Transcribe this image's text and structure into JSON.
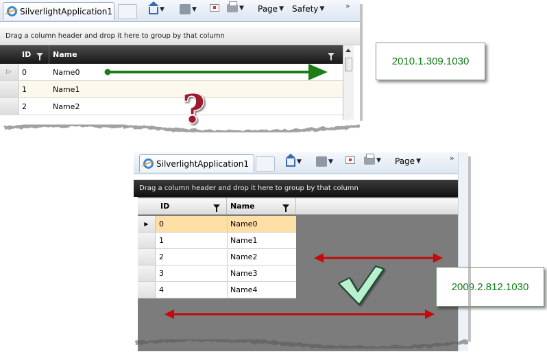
{
  "colors": {
    "arrow_green": "#1e7d16",
    "arrow_red": "#c40a0a",
    "question_mark": "#9e1a2e",
    "check_mark": "#b9f0cf",
    "version_text": "#0e7a14",
    "selected_row": "#ffdfa6"
  },
  "top_shot": {
    "tab_title": "SilverlightApplication1",
    "toolbar": {
      "page_label": "Page",
      "safety_label": "Safety"
    },
    "group_panel_text": "Drag a column header and drop it here to group by that column",
    "columns": [
      "ID",
      "Name"
    ],
    "rows": [
      {
        "id": "0",
        "name": "Name0"
      },
      {
        "id": "1",
        "name": "Name1"
      },
      {
        "id": "2",
        "name": "Name2"
      }
    ]
  },
  "top_version": "2010.1.309.1030",
  "bottom_shot": {
    "tab_title": "SilverlightApplication1",
    "toolbar": {
      "page_label": "Page"
    },
    "group_panel_text": "Drag a column header and drop it here to group by that column",
    "columns": [
      "ID",
      "Name"
    ],
    "rows": [
      {
        "id": "0",
        "name": "Name0"
      },
      {
        "id": "1",
        "name": "Name1"
      },
      {
        "id": "2",
        "name": "Name2"
      },
      {
        "id": "3",
        "name": "Name3"
      },
      {
        "id": "4",
        "name": "Name4"
      }
    ]
  },
  "bottom_version": "2009.2.812.1030"
}
